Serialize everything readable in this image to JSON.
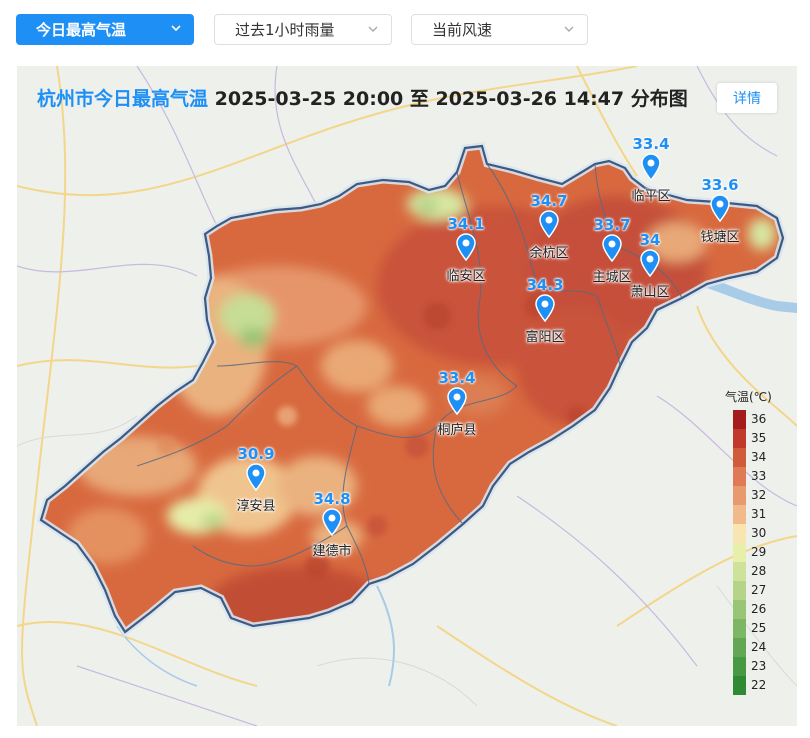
{
  "dropdowns": {
    "temp_label": "今日最高气温",
    "rain_label": "过去1小时雨量",
    "wind_label": "当前风速"
  },
  "map": {
    "title_city": "杭州市今日最高气温",
    "title_rest": " 2025-03-25 20:00 至 2025-03-26 14:47 分布图",
    "detail_label": "详情",
    "markers": [
      {
        "name": "临平区",
        "value": "33.4"
      },
      {
        "name": "钱塘区",
        "value": "33.6"
      },
      {
        "name": "余杭区",
        "value": "34.7"
      },
      {
        "name": "临安区",
        "value": "34.1"
      },
      {
        "name": "主城区",
        "value": "33.7"
      },
      {
        "name": "萧山区",
        "value": "34"
      },
      {
        "name": "富阳区",
        "value": "34.3"
      },
      {
        "name": "桐庐县",
        "value": "33.4"
      },
      {
        "name": "淳安县",
        "value": "30.9"
      },
      {
        "name": "建德市",
        "value": "34.8"
      }
    ]
  },
  "legend": {
    "title": "气温(℃)",
    "ticks": [
      "36",
      "35",
      "34",
      "33",
      "32",
      "31",
      "30",
      "29",
      "28",
      "27",
      "26",
      "25",
      "24",
      "23",
      "22"
    ],
    "colors": [
      "#a51c1c",
      "#c0392b",
      "#d05a3c",
      "#de7a55",
      "#e89a6e",
      "#f0ba8a",
      "#f8e5b2",
      "#e8efaa",
      "#cfe29a",
      "#b5d488",
      "#99c676",
      "#7db765",
      "#62a854",
      "#489944",
      "#2f8a35"
    ]
  },
  "colors": {
    "accent": "#1e90f5",
    "heat": "#d4643f",
    "border": "#3c5a82"
  }
}
